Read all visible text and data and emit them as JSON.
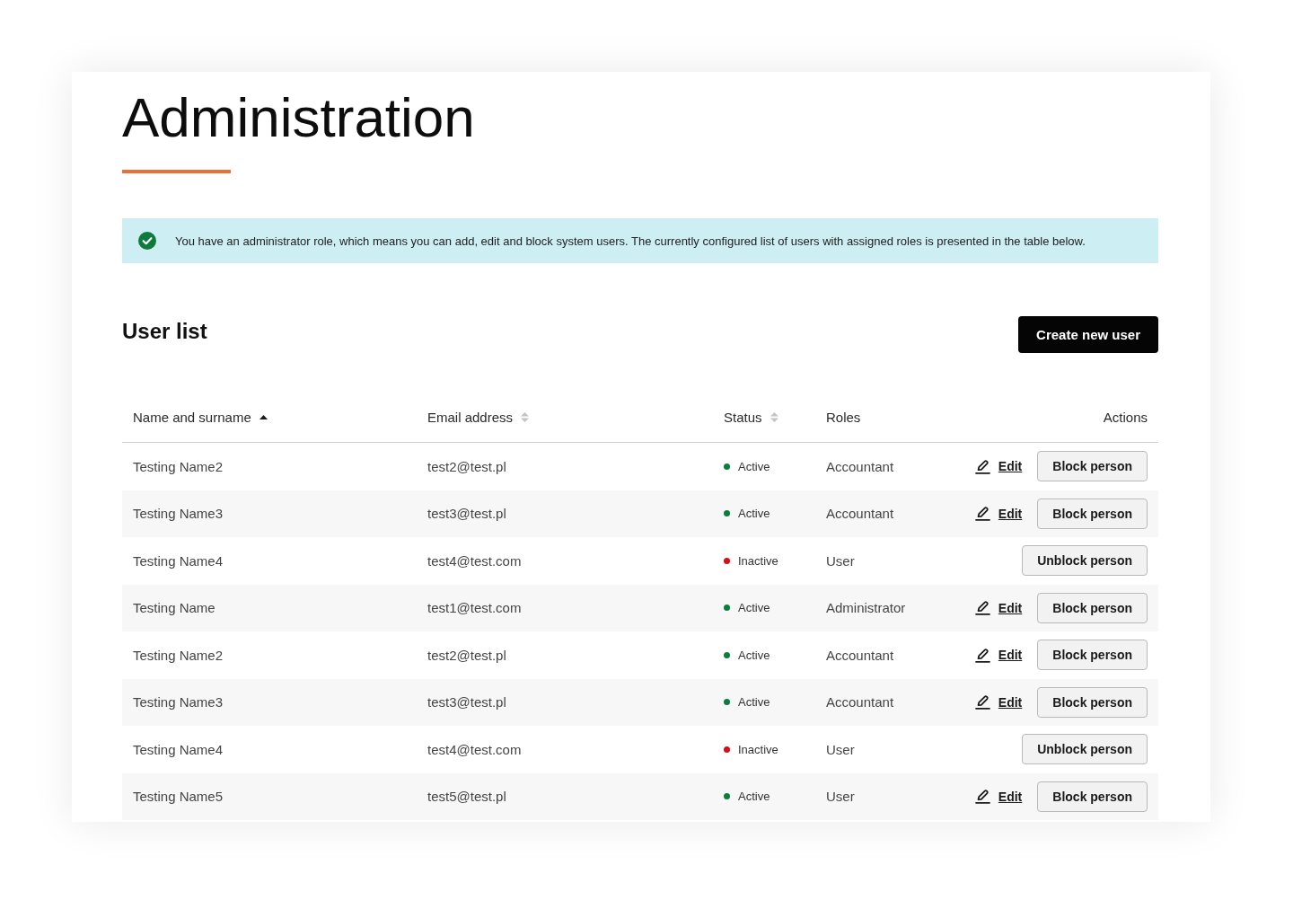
{
  "page": {
    "title": "Administration"
  },
  "alert": {
    "text": "You have an administrator role, which means you can add, edit and block system users. The currently configured list of users with assigned roles is presented in the table below."
  },
  "user_list": {
    "title": "User list",
    "create_button": "Create new user"
  },
  "table": {
    "columns": [
      {
        "label": "Name and surname",
        "sortable": true,
        "sorted": true
      },
      {
        "label": "Email address",
        "sortable": true,
        "sorted": false
      },
      {
        "label": "Status",
        "sortable": true,
        "sorted": false
      },
      {
        "label": "Roles",
        "sortable": false,
        "sorted": false
      },
      {
        "label": "Actions",
        "sortable": false,
        "sorted": false
      }
    ],
    "rows": [
      {
        "name": "Testing Name2",
        "email": "test2@test.pl",
        "status": {
          "label": "Active",
          "color": "#0b7d3e"
        },
        "role": "Accountant",
        "actions": [
          {
            "kind": "link",
            "label": "Edit"
          },
          {
            "kind": "button",
            "label": "Block person"
          }
        ]
      },
      {
        "name": "Testing Name3",
        "email": "test3@test.pl",
        "status": {
          "label": "Active",
          "color": "#0b7d3e"
        },
        "role": "Accountant",
        "actions": [
          {
            "kind": "link",
            "label": "Edit"
          },
          {
            "kind": "button",
            "label": "Block person"
          }
        ]
      },
      {
        "name": "Testing Name4",
        "email": "test4@test.com",
        "status": {
          "label": "Inactive",
          "color": "#d0101b"
        },
        "role": "User",
        "actions": [
          {
            "kind": "button",
            "label": "Unblock person"
          }
        ]
      },
      {
        "name": "Testing Name",
        "email": "test1@test.com",
        "status": {
          "label": "Active",
          "color": "#0b7d3e"
        },
        "role": "Administrator",
        "actions": [
          {
            "kind": "link",
            "label": "Edit"
          },
          {
            "kind": "button",
            "label": "Block person"
          }
        ]
      },
      {
        "name": "Testing Name2",
        "email": "test2@test.pl",
        "status": {
          "label": "Active",
          "color": "#0b7d3e"
        },
        "role": "Accountant",
        "actions": [
          {
            "kind": "link",
            "label": "Edit"
          },
          {
            "kind": "button",
            "label": "Block person"
          }
        ]
      },
      {
        "name": "Testing Name3",
        "email": "test3@test.pl",
        "status": {
          "label": "Active",
          "color": "#0b7d3e"
        },
        "role": "Accountant",
        "actions": [
          {
            "kind": "link",
            "label": "Edit"
          },
          {
            "kind": "button",
            "label": "Block person"
          }
        ]
      },
      {
        "name": "Testing Name4",
        "email": "test4@test.com",
        "status": {
          "label": "Inactive",
          "color": "#d0101b"
        },
        "role": "User",
        "actions": [
          {
            "kind": "button",
            "label": "Unblock person"
          }
        ]
      },
      {
        "name": "Testing Name5",
        "email": "test5@test.pl",
        "status": {
          "label": "Active",
          "color": "#0b7d3e"
        },
        "role": "User",
        "actions": [
          {
            "kind": "link",
            "label": "Edit"
          },
          {
            "kind": "button",
            "label": "Block person"
          }
        ]
      }
    ]
  }
}
